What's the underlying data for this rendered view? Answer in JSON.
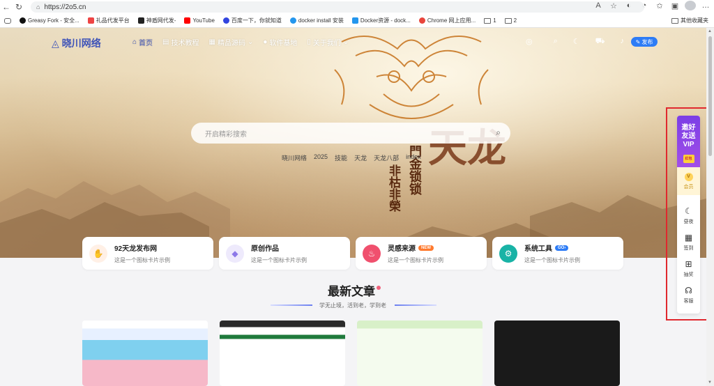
{
  "browser": {
    "url": "https://2o5.cn",
    "bookmarks": [
      {
        "label": "Greasy Fork - 安全...",
        "color": "#111"
      },
      {
        "label": "礼品代发平台",
        "color": "#e44"
      },
      {
        "label": "神盾网代发-",
        "color": "#222"
      },
      {
        "label": "YouTube",
        "color": "#f00"
      },
      {
        "label": "百度一下，你就知道",
        "color": "#3245df"
      },
      {
        "label": "docker install 安装",
        "color": "#2496ed"
      },
      {
        "label": "Docker资源 - dock...",
        "color": "#2496ed"
      },
      {
        "label": "Chrome 网上应用...",
        "color": "#e8453c"
      },
      {
        "label": "1",
        "color": ""
      },
      {
        "label": "2",
        "color": ""
      }
    ],
    "other_bookmarks": "其他收藏夹"
  },
  "site": {
    "logo": "晓川网络",
    "menu": [
      {
        "label": "首页",
        "icon": "home-icon"
      },
      {
        "label": "技术教程",
        "icon": "book-icon"
      },
      {
        "label": "精品源码",
        "icon": "code-icon"
      },
      {
        "label": "软件基地",
        "icon": "app-icon"
      },
      {
        "label": "关于我们",
        "icon": "info-icon"
      }
    ],
    "publish": "发布"
  },
  "hero": {
    "search_placeholder": "开启精彩搜索",
    "tags": [
      "晓川网络",
      "2025",
      "技能",
      "天龙",
      "天龙八部",
      "index"
    ],
    "calligraphy": {
      "main": "天龙",
      "side1": "門金锁锁",
      "side2": "非枯非榮"
    }
  },
  "cards": [
    {
      "title": "92天龙发布网",
      "desc": "这是一个图标卡片示例",
      "badge": "",
      "icon_bg": "#fff0e6",
      "icon_color": "#f08a3c"
    },
    {
      "title": "原创作品",
      "desc": "这是一个图标卡片示例",
      "badge": "",
      "icon_bg": "#eeeafc",
      "icon_color": "#8c78e8"
    },
    {
      "title": "灵感来源",
      "desc": "这是一个图标卡片示例",
      "badge": "NEW",
      "icon_bg": "#fde8ee",
      "icon_color": "#f0506e"
    },
    {
      "title": "系统工具",
      "desc": "这是一个图标卡片示例",
      "badge": "GO",
      "icon_bg": "#e2f7f4",
      "icon_color": "#19b3a6"
    }
  ],
  "section": {
    "title": "最新文章",
    "subtitle": "学无止境，活到老，学到老"
  },
  "float": {
    "vip": "邀好友送VIP",
    "envelope": "红包",
    "member": "会员",
    "items": [
      "昼夜",
      "签到",
      "抽奖",
      "客服"
    ]
  }
}
